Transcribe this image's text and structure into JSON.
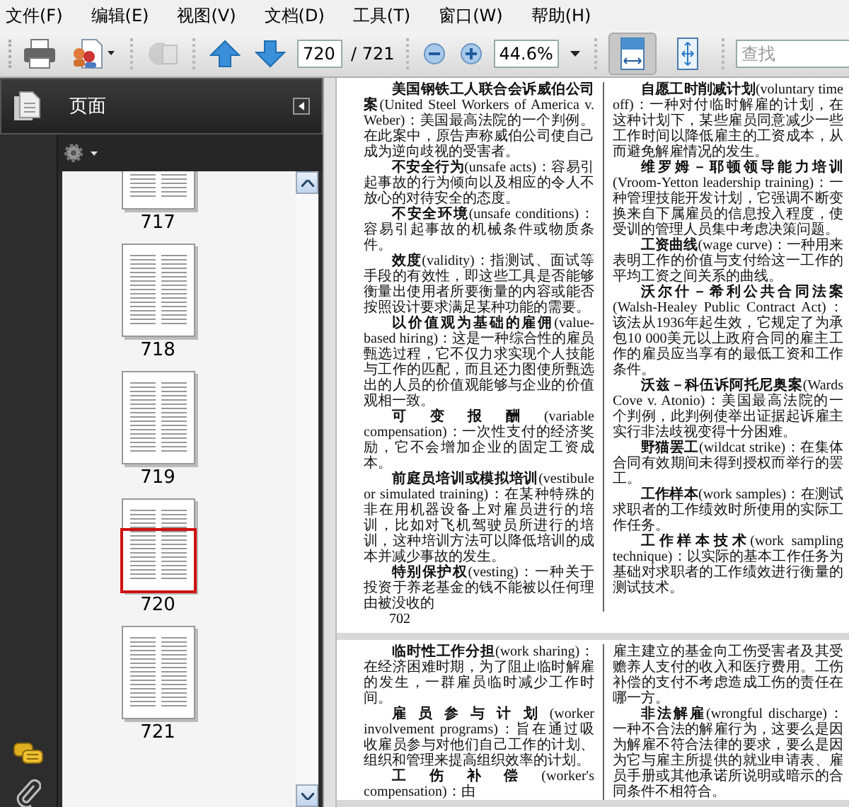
{
  "menu": [
    "文件(F)",
    "编辑(E)",
    "视图(V)",
    "文档(D)",
    "工具(T)",
    "窗口(W)",
    "帮助(H)"
  ],
  "toolbar": {
    "tools": [
      {
        "kind": "print",
        "disabled": false
      },
      {
        "kind": "share",
        "disabled": false
      },
      {
        "kind": "collaborate",
        "disabled": true
      }
    ],
    "page_field": {
      "value": "720"
    },
    "page_total": "/ 721",
    "zoom_field": {
      "value": "44.6%"
    },
    "view_modes": [
      {
        "kind": "fit-width",
        "selected": true
      },
      {
        "kind": "fit-page",
        "selected": false
      }
    ],
    "search": {
      "placeholder": "查找"
    }
  },
  "sidebar": {
    "title": "页面",
    "thumbnails": [
      {
        "label": "717",
        "selected": false
      },
      {
        "label": "718",
        "selected": false
      },
      {
        "label": "719",
        "selected": false
      },
      {
        "label": "720",
        "selected": true
      },
      {
        "label": "721",
        "selected": false
      }
    ]
  },
  "pages": [
    {
      "columns": [
        [
          {
            "kind": "entry",
            "text": "**美国钢铁工人联合会诉威伯公司案**(United Steel Workers of America v. Weber)：美国最高法院的一个判例。在此案中，原告声称威伯公司使自己成为逆向歧视的受害者。"
          },
          {
            "kind": "entry",
            "text": "**不安全行为**(unsafe acts)：容易引起事故的行为倾向以及相应的令人不放心的对待安全的态度。"
          },
          {
            "kind": "entry",
            "text": "**不安全环境**(unsafe conditions)：容易引起事故的机械条件或物质条件。"
          },
          {
            "kind": "entry",
            "text": "**效度**(validity)：指测试、面试等手段的有效性，即这些工具是否能够衡量出使用者所要衡量的内容或能否按照设计要求满足某种功能的需要。"
          },
          {
            "kind": "entry",
            "text": "**以价值观为基础的雇佣**(value-based hiring)：这是一种综合性的雇员甄选过程，它不仅力求实现个人技能与工作的匹配，而且还力图使所甄选出的人员的价值观能够与企业的价值观相一致。"
          },
          {
            "kind": "entry",
            "text": "**可变报酬**(variable compensation)：一次性支付的经济奖励，它不会增加企业的固定工资成本。"
          },
          {
            "kind": "entry",
            "text": "**前庭员培训或模拟培训**(vestibule or simulated training)：在某种特殊的非在用机器设备上对雇员进行的培训，比如对飞机驾驶员所进行的培训，这种培训方法可以降低培训的成本并减少事故的发生。"
          },
          {
            "kind": "entry",
            "text": "**特别保护权**(vesting)：一种关于投资于养老基金的钱不能被以任何理由被没收的"
          }
        ],
        [
          {
            "kind": "entry",
            "text": "**自愿工时削减计划**(voluntary time off)：一种对付临时解雇的计划，在这种计划下，某些雇员同意减少一些工作时间以降低雇主的工资成本，从而避免解雇情况的发生。"
          },
          {
            "kind": "entry",
            "text": "**维罗姆－耶顿领导能力培训**(Vroom-Yetton leadership training)：一种管理技能开发计划，它强调不断变换来自下属雇员的信息投入程度，使受训的管理人员集中考虑决策问题。"
          },
          {
            "kind": "entry",
            "text": "**工资曲线**(wage curve)：一种用来表明工作的价值与支付给这一工作的平均工资之间关系的曲线。"
          },
          {
            "kind": "entry",
            "text": "**沃尔什－希利公共合同法案**(Walsh-Healey Public Contract Act)：该法从1936年起生效，它规定了为承包10 000美元以上政府合同的雇主工作的雇员应当享有的最低工资和工作条件。"
          },
          {
            "kind": "entry",
            "text": "**沃兹－科伍诉阿托尼奥案**(Wards Cove v. Atonio)：美国最高法院的一个判例，此判例使举出证据起诉雇主实行非法歧视变得十分困难。"
          },
          {
            "kind": "entry",
            "text": "**野猫罢工**(wildcat strike)：在集体合同有效期间未得到授权而举行的罢工。"
          },
          {
            "kind": "entry",
            "text": "**工作样本**(work samples)：在测试求职者的工作绩效时所使用的实际工作任务。"
          },
          {
            "kind": "entry",
            "text": "**工作样本技术**(work sampling technique)：以实际的基本工作任务为基础对求职者的工作绩效进行衡量的测试技术。"
          }
        ]
      ],
      "page_number": "702"
    },
    {
      "columns": [
        [
          {
            "kind": "entry",
            "text": "**临时性工作分担**(work sharing)：在经济困难时期，为了阻止临时解雇的发生，一群雇员临时减少工作时间。"
          },
          {
            "kind": "entry",
            "text": "**雇员参与计划**(worker involvement programs)：旨在通过吸收雇员参与对他们自己工作的计划、组织和管理来提高组织效率的计划。"
          },
          {
            "kind": "entry",
            "text": "**工伤补偿**(worker's compensation)：由"
          }
        ],
        [
          {
            "kind": "continuation",
            "text": "雇主建立的基金向工伤受害者及其受赡养人支付的收入和医疗费用。工伤补偿的支付不考虑造成工伤的责任在哪一方。"
          },
          {
            "kind": "entry",
            "text": "**非法解雇**(wrongful discharge)：一种不合法的解雇行为，这要么是因为解雇不符合法律的要求，要么是因为它与雇主所提供的就业申请表、雇员手册或其他承诺所说明或暗示的合同条件不相符合。"
          }
        ]
      ]
    }
  ]
}
